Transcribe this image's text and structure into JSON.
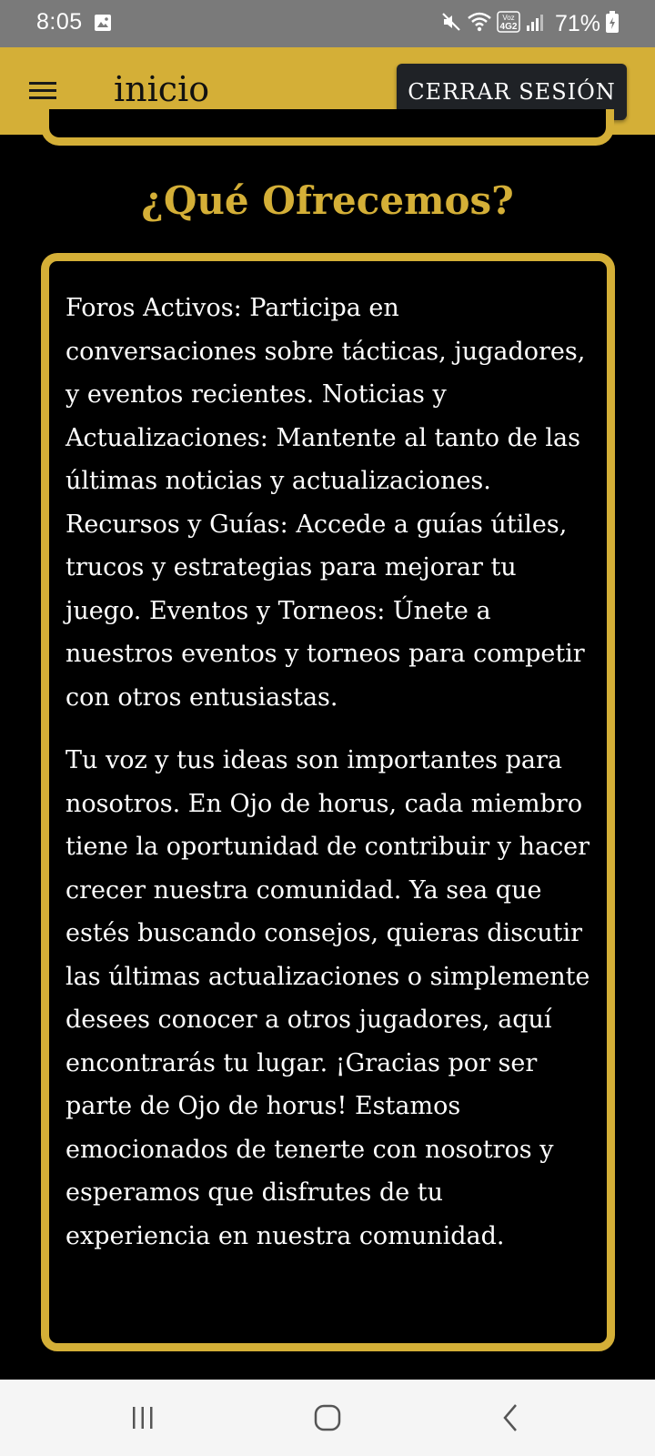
{
  "status_bar": {
    "time": "8:05",
    "battery": "71%",
    "network": "Voz 4G2",
    "icons": [
      "image-icon",
      "mute-icon",
      "wifi-icon",
      "signal-icon",
      "battery-icon"
    ]
  },
  "app_bar": {
    "title": "inicio",
    "logout_label": "CERRAR SESIÓN",
    "menu_icon": "hamburger-menu-icon",
    "background": "#d4af37"
  },
  "section": {
    "heading": "¿Qué Ofrecemos?",
    "paragraphs": [
      "Foros Activos: Participa en conversaciones sobre tácticas, jugadores, y eventos recientes. Noticias y Actualizaciones: Mantente al tanto de las últimas noticias y actualizaciones. Recursos y Guías: Accede a guías útiles, trucos y estrategias para mejorar tu juego. Eventos y Torneos: Únete a nuestros eventos y torneos para competir con otros entusiastas.",
      "Tu voz y tus ideas son importantes para nosotros. En Ojo de horus, cada miembro tiene la oportunidad de contribuir y hacer crecer nuestra comunidad. Ya sea que estés buscando consejos, quieras discutir las últimas actualizaciones o simplemente desees conocer a otros jugadores, aquí encontrarás tu lugar. ¡Gracias por ser parte de Ojo de horus! Estamos emocionados de tenerte con nosotros y esperamos que disfrutes de tu experiencia en nuestra comunidad."
    ]
  },
  "nav_bar": {
    "buttons": [
      "recent-apps-icon",
      "home-icon",
      "back-icon"
    ]
  },
  "colors": {
    "accent": "#d4af37",
    "background": "#000000",
    "button_dark": "#1f2226",
    "text": "#ffffff"
  }
}
